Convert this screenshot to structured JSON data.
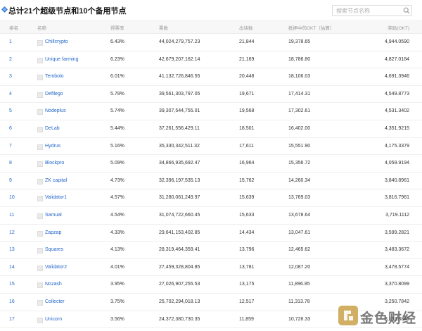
{
  "header": {
    "title": "总计21个超级节点和10个备用节点",
    "search_placeholder": "搜索节点名称"
  },
  "table": {
    "columns": [
      "排名",
      "名称",
      "得票率",
      "票数",
      "出块数",
      "抵押中的OKT（估算）",
      "奖励(OKT)"
    ],
    "rows": [
      {
        "rank": "1",
        "name": "Chillcrypto",
        "rate": "6.43%",
        "votes": "44,024,279,757.23",
        "blocks": "21,844",
        "locked": "19,378.65",
        "reward": "4,944.0590"
      },
      {
        "rank": "2",
        "name": "Unique farming",
        "rate": "6.23%",
        "votes": "42,679,207,162.14",
        "blocks": "21,169",
        "locked": "18,786.80",
        "reward": "4,827.0184"
      },
      {
        "rank": "3",
        "name": "Tembolo",
        "rate": "6.01%",
        "votes": "41,132,726,846.55",
        "blocks": "20,448",
        "locked": "18,106.03",
        "reward": "4,691.3946"
      },
      {
        "rank": "4",
        "name": "Defilego",
        "rate": "5.78%",
        "votes": "39,561,303,797.05",
        "blocks": "19,671",
        "locked": "17,414.31",
        "reward": "4,549.8773"
      },
      {
        "rank": "5",
        "name": "Nodeplus",
        "rate": "5.74%",
        "votes": "39,307,544,755.01",
        "blocks": "19,568",
        "locked": "17,302.61",
        "reward": "4,531.3402"
      },
      {
        "rank": "6",
        "name": "DeLab",
        "rate": "5.44%",
        "votes": "37,261,556,429.11",
        "blocks": "18,501",
        "locked": "16,402.00",
        "reward": "4,351.9215"
      },
      {
        "rank": "7",
        "name": "Hydrus",
        "rate": "5.16%",
        "votes": "35,330,342,511.32",
        "blocks": "17,611",
        "locked": "15,551.90",
        "reward": "4,175.3379"
      },
      {
        "rank": "8",
        "name": "Blockpro",
        "rate": "5.09%",
        "votes": "34,866,935,692.47",
        "blocks": "16,964",
        "locked": "15,356.72",
        "reward": "4,059.9194"
      },
      {
        "rank": "9",
        "name": "ZK capital",
        "rate": "4.73%",
        "votes": "32,396,197,535.13",
        "blocks": "15,762",
        "locked": "14,260.34",
        "reward": "3,840.8961"
      },
      {
        "rank": "10",
        "name": "Validator1",
        "rate": "4.57%",
        "votes": "31,280,061,249.97",
        "blocks": "15,639",
        "locked": "13,769.03",
        "reward": "3,816.7961"
      },
      {
        "rank": "11",
        "name": "Samual",
        "rate": "4.54%",
        "votes": "31,074,722,660.45",
        "blocks": "15,633",
        "locked": "13,678.64",
        "reward": "3,719.1112"
      },
      {
        "rank": "12",
        "name": "Zapzap",
        "rate": "4.33%",
        "votes": "29,641,153,402.85",
        "blocks": "14,434",
        "locked": "13,047.61",
        "reward": "3,599.2821"
      },
      {
        "rank": "13",
        "name": "Squares",
        "rate": "4.13%",
        "votes": "28,319,464,359.41",
        "blocks": "13,796",
        "locked": "12,465.62",
        "reward": "3,483.3672"
      },
      {
        "rank": "14",
        "name": "Validator2",
        "rate": "4.01%",
        "votes": "27,459,328,804.85",
        "blocks": "13,781",
        "locked": "12,087.20",
        "reward": "3,478.5774"
      },
      {
        "rank": "15",
        "name": "Nozash",
        "rate": "3.95%",
        "votes": "27,026,907,255.53",
        "blocks": "13,175",
        "locked": "11,896.85",
        "reward": "3,370.8099"
      },
      {
        "rank": "16",
        "name": "Collecter",
        "rate": "3.75%",
        "votes": "25,702,294,018.13",
        "blocks": "12,517",
        "locked": "11,313.78",
        "reward": "3,250.7842"
      },
      {
        "rank": "17",
        "name": "Unicorn",
        "rate": "3.56%",
        "votes": "24,372,380,730.35",
        "blocks": "11,859",
        "locked": "10,726.33",
        "reward": "3,153.8845"
      }
    ]
  },
  "watermark": {
    "text": "金色财经"
  },
  "colors": {
    "link": "#2468c8",
    "header_bg": "#f7f7f7",
    "icon_blue": "#3a7bd5",
    "watermark_gold": "#c9a24a"
  },
  "icons": [
    "diamond-icon",
    "search-icon",
    "node-logo",
    "watermark-logo"
  ]
}
